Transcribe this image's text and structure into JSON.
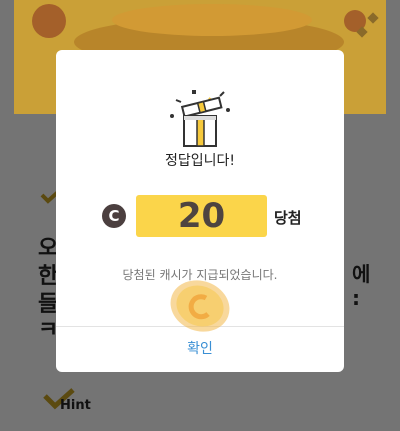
{
  "background": {
    "hint_label": "Hint",
    "lines": [
      "오",
      "한",
      "들",
      "ㅋ"
    ]
  },
  "modal": {
    "title": "정답입니다!",
    "coin_symbol": "C",
    "amount": "20",
    "amount_suffix": "당첨",
    "description": "당첨된 캐시가 지급되었습니다.",
    "confirm_label": "확인"
  },
  "colors": {
    "accent_yellow": "#fbd54a",
    "confirm_blue": "#3a8fd4",
    "coin_dark": "#4b3f3f"
  }
}
